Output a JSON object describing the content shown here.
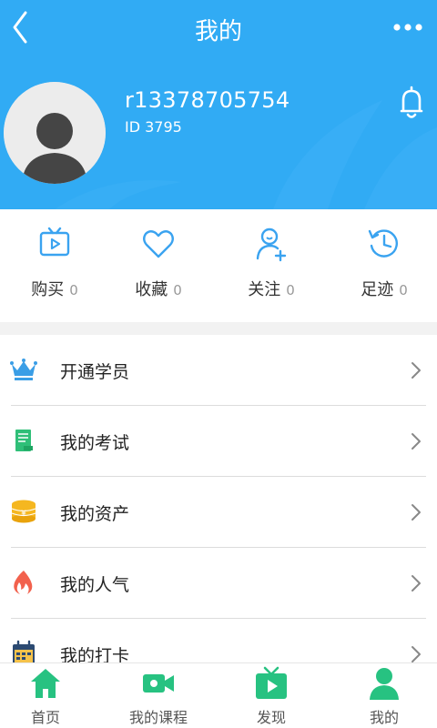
{
  "header": {
    "title": "我的",
    "username": "r13378705754",
    "user_id": "ID 3795"
  },
  "stats": [
    {
      "label": "购买",
      "count": "0",
      "icon": "tv-play-icon"
    },
    {
      "label": "收藏",
      "count": "0",
      "icon": "heart-icon"
    },
    {
      "label": "关注",
      "count": "0",
      "icon": "user-add-icon"
    },
    {
      "label": "足迹",
      "count": "0",
      "icon": "history-clock-icon"
    }
  ],
  "menu": [
    {
      "label": "开通学员",
      "icon": "crown-icon"
    },
    {
      "label": "我的考试",
      "icon": "exam-book-icon"
    },
    {
      "label": "我的资产",
      "icon": "coins-icon"
    },
    {
      "label": "我的人气",
      "icon": "flame-icon"
    },
    {
      "label": "我的打卡",
      "icon": "calendar-icon"
    }
  ],
  "tabs": [
    {
      "label": "首页",
      "icon": "home-icon"
    },
    {
      "label": "我的课程",
      "icon": "video-camera-icon"
    },
    {
      "label": "发现",
      "icon": "tv-play-icon"
    },
    {
      "label": "我的",
      "icon": "user-icon"
    }
  ],
  "colors": {
    "header_bg": "#31abf4",
    "accent_blue": "#3aa3f0",
    "tab_green": "#27c281"
  }
}
